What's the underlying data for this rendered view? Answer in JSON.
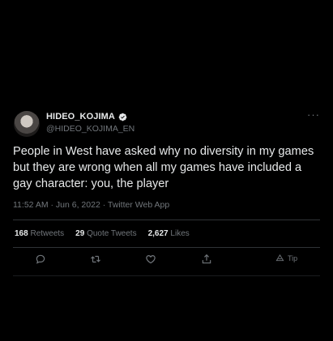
{
  "author": {
    "name": "HIDEO_KOJIMA",
    "handle": "@HIDEO_KOJIMA_EN"
  },
  "tweet": {
    "text": "People in West have asked why no diversity in my games but they are wrong when all my games have included a gay character: you, the player",
    "meta": "11:52 AM · Jun 6, 2022 · Twitter Web App"
  },
  "stats": {
    "retweets_count": "168",
    "retweets_label": "Retweets",
    "quotes_count": "29",
    "quotes_label": "Quote Tweets",
    "likes_count": "2,627",
    "likes_label": "Likes"
  },
  "actions": {
    "more": "···",
    "tip_label": "Tip"
  },
  "colors": {
    "background": "#000000",
    "text": "#e7e9ea",
    "muted": "#71767b",
    "verified": "#e7e9ea"
  }
}
